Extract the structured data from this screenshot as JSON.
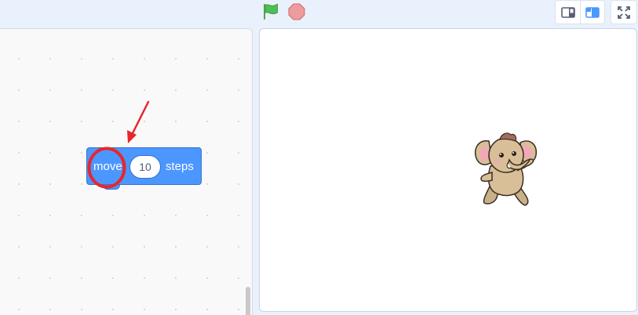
{
  "toolbar": {
    "green_flag_icon": "green-flag-icon",
    "stop_icon": "stop-sign-icon",
    "layout_buttons": [
      "small-stage-icon",
      "normal-stage-icon",
      "fullscreen-icon"
    ]
  },
  "code_area": {
    "block": {
      "category": "motion",
      "label": "move",
      "value": "10",
      "suffix": "steps"
    }
  },
  "stage": {
    "sprite": "elephant-sprite"
  },
  "annotation": {
    "arrow_color": "#e8262c",
    "circle_color": "#e8262c"
  },
  "colors": {
    "motion_block": "#4c97ff",
    "background": "#e9f1fc",
    "accent": "#4c97ff"
  }
}
